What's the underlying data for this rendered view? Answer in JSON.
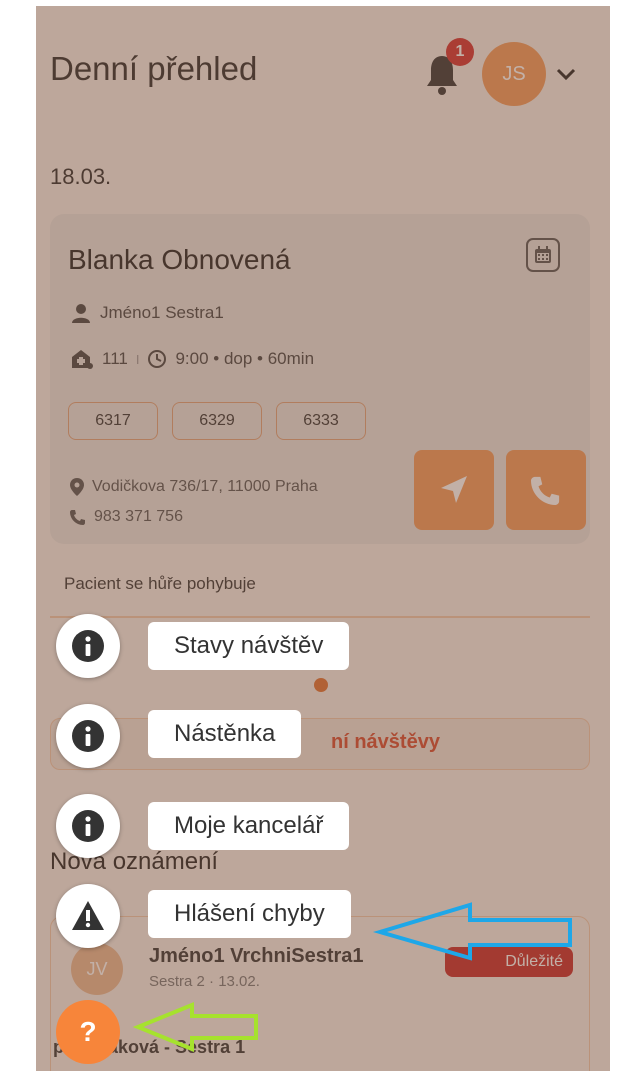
{
  "header": {
    "title": "Denní přehled",
    "notification_count": "1",
    "avatar_initials": "JS"
  },
  "date": "18.03.",
  "visit": {
    "patient_name": "Blanka Obnovená",
    "nurse": "Jméno1 Sestra1",
    "room": "111",
    "separator": "I",
    "time": "9:00 • dop • 60min",
    "codes": [
      "6317",
      "6329",
      "6333"
    ],
    "address": "Vodičkova 736/17, 11000 Praha",
    "phone": "983 371 756"
  },
  "note": "Pacient se hůře pohybuje",
  "visits_button_partial": "ní návštěvy",
  "announcements": {
    "title": "Nová oznámení",
    "author_initials": "JV",
    "author": "Jméno1 VrchniSestra1",
    "meta": "Sestra 2 · 13.02.",
    "badge": "Důležité",
    "line": "p. Nováková - Sestra 1"
  },
  "fab_menu": {
    "items": [
      {
        "label": "Stavy návštěv",
        "icon": "info-icon"
      },
      {
        "label": "Nástěnka",
        "icon": "info-icon"
      },
      {
        "label": "Moje kancelář",
        "icon": "info-icon"
      },
      {
        "label": "Hlášení chyby",
        "icon": "warning-icon"
      }
    ],
    "help_label": "?"
  },
  "colors": {
    "accent": "#f29a5a",
    "danger": "#d32f2f",
    "annotation_blue": "#1ea7e8",
    "annotation_green": "#a6e22e"
  }
}
